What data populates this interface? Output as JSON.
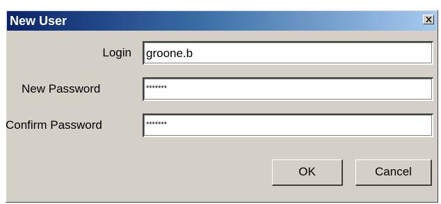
{
  "window": {
    "title": "New User"
  },
  "form": {
    "login_label": "Login",
    "login_value": "groone.b",
    "new_password_label": "New Password",
    "new_password_value": "*******",
    "confirm_password_label": "Confirm Password",
    "confirm_password_value": "*******"
  },
  "buttons": {
    "ok_label": "OK",
    "cancel_label": "Cancel"
  },
  "icons": {
    "close": "close-icon"
  },
  "colors": {
    "title_start": "#0a246a",
    "title_end": "#a6caf0",
    "face": "#d4d0c8"
  }
}
